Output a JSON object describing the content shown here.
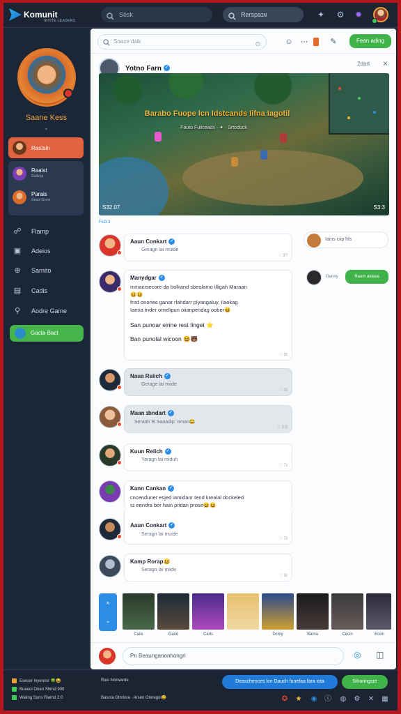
{
  "header": {
    "app_name": "Komunit",
    "app_sub": "INVITE LEADERS",
    "search_placeholder": "Sѐsk",
    "search2_placeholder": "Rerspaɪɴ",
    "icons": [
      "controller-icon",
      "gear-icon",
      "settings-icon"
    ]
  },
  "sidebar": {
    "profile_name": "Saane Kess",
    "chevron": "⌄",
    "active_item": {
      "label": "Rastsin"
    },
    "items": [
      {
        "label": "Raaist",
        "sub": "Gallerja"
      },
      {
        "label": "Parais",
        "sub": "Gʀais Gᴀine"
      }
    ],
    "nav": [
      {
        "label": "Flamp",
        "icon": "flame-icon"
      },
      {
        "label": "Adeios",
        "icon": "image-icon"
      },
      {
        "label": "Sarnito",
        "icon": "globe-icon"
      },
      {
        "label": "Cadis",
        "icon": "folder-icon"
      },
      {
        "label": "Aodre Game",
        "icon": "link-icon"
      }
    ],
    "green_button": "Gacta Bact"
  },
  "main": {
    "search_placeholder": "Soace daik",
    "top_button": "Fean ading",
    "post": {
      "author": "Yotno Farn",
      "time": "2dart",
      "close": "×",
      "game_title": "Barabo Fuope lcn Idstcands Iifna Iagotil",
      "game_sub": "Fauto Fuiiceads  ·  ✦  ·  Srtoduck",
      "game_left": "S32.07",
      "game_right": "S3:3"
    },
    "section_label": "Fisd 3",
    "messages": [
      {
        "name": "Aaun Conkart",
        "sub": "Geragn lai muide",
        "meta": "♡ 3?",
        "grey": false
      },
      {
        "name": "Manydgar",
        "lines": [
          "mmacrsecore da bolkand sbeolamo illigah Maraan",
          "😆😆",
          "fnrd onories ganar rlahdarr plyangaluy, Iiaokag",
          "Iaeoa tnder ornelipun oiianpendag oober😆"
        ],
        "big1": "San punoar eirine rest Iinget ⭐",
        "big2": "Ban punolal wicoon 😆🐻",
        "meta": "♡ 3ɪ",
        "grey": false
      },
      {
        "name": "Naua Reiich",
        "sub": "Gerage lai miide",
        "meta": "♡ 2ɪ",
        "grey": true
      },
      {
        "name": "Maan ɪbndart",
        "sub": "Seradn Ɓ Saoadip: oman😂",
        "meta": "♡ 2:0",
        "grey": true
      },
      {
        "name": "Kuun Reiich",
        "sub": "Yaragn lai miduh",
        "meta": "♡ 7ɪ",
        "grey": false
      },
      {
        "name": "Kann Cankan",
        "lines": [
          "cncenduner esjed iamidanr tend krealal dockeled",
          "sɪ eendra bor hain pridan prose😆😆"
        ],
        "meta": "",
        "grey": false
      },
      {
        "name": "Aaun Conkart",
        "sub": "Seragn lai muide",
        "meta": "♡ 7ɪ",
        "grey": false
      },
      {
        "name": "Kamp Rorap😆",
        "sub": "Seragn lai miide",
        "meta": "♡ 3ɪ",
        "grey": false
      }
    ],
    "right_card": "Iains ciip hls",
    "right_row": {
      "label": "Ganny",
      "button": "Raum aidasa"
    },
    "strip": {
      "button": "»",
      "button2": "⌄",
      "thumbs": [
        "Caiis",
        "Gaoo",
        "Carls",
        "",
        "Dcmy",
        "Bama",
        "Cecin",
        "Ecen"
      ]
    },
    "composer": {
      "placeholder": "Pn Beaunganonhongri"
    }
  },
  "footer": {
    "left": [
      {
        "text": "Eseuor lnyenssr 🍀😆",
        "color": "#e8a33a"
      },
      {
        "text": "Bueeoi Onen Shrnd 900",
        "color": "#3ecb5a"
      },
      {
        "text": "Waiing Sons Riamd 2:0",
        "color": "#3ecb5a"
      }
    ],
    "mid1": "Rasl Norwarde",
    "mid2": "Basota Otmiora  ·  Arsen Onnegoi😆",
    "blue_button": "Deaschences lcn Dauch funefaa lara iota",
    "green_button": "Sihoringsɪe",
    "icons": [
      "game-icon",
      "star-icon",
      "help-icon",
      "info-icon",
      "chat-icon",
      "settings-icon",
      "close-icon",
      "grid-icon"
    ]
  }
}
